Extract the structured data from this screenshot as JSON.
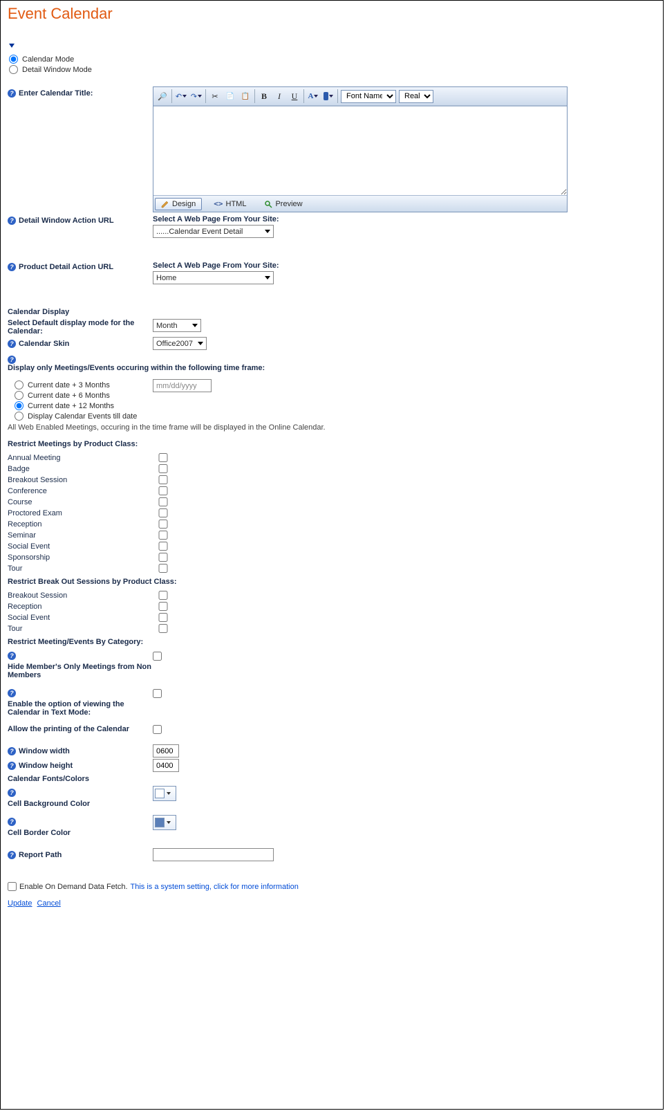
{
  "title": "Event Calendar",
  "mode": {
    "calendar": "Calendar Mode",
    "detail": "Detail Window Mode"
  },
  "labels": {
    "enter_title": "Enter Calendar Title:",
    "detail_action": "Detail Window Action URL",
    "product_action": "Product Detail Action URL",
    "select_page": "Select A Web Page From Your Site:",
    "calendar_display": "Calendar Display",
    "default_display": "Select Default display mode for the Calendar:",
    "calendar_skin": "Calendar Skin",
    "timeframe_intro": "Display only Meetings/Events occuring within the following time frame:",
    "note": "All Web Enabled Meetings, occuring in the time frame will be displayed in the Online Calendar.",
    "restrict_product": "Restrict Meetings by Product Class:",
    "restrict_breakout": "Restrict Break Out Sessions by Product Class:",
    "restrict_category": "Restrict Meeting/Events By Category:",
    "hide_member": "Hide Member's Only Meetings from Non Members",
    "enable_text": "Enable the option of viewing the Calendar in Text Mode:",
    "allow_print": "Allow the printing of the Calendar",
    "win_width": "Window width",
    "win_height": "Window height",
    "fonts_colors": "Calendar Fonts/Colors",
    "cell_bg": "Cell Background Color",
    "cell_border": "Cell Border Color",
    "report_path": "Report Path",
    "ondemand": "Enable On Demand Data Fetch.",
    "ondemand_note": "This is a system setting, click for more information"
  },
  "rte": {
    "font_name": "Font Name",
    "real_size": "Real ...",
    "tab_design": "Design",
    "tab_html": "HTML",
    "tab_preview": "Preview"
  },
  "selects": {
    "detail_page": "......Calendar Event Detail",
    "product_page": "Home",
    "display_mode": "Month",
    "skin": "Office2007"
  },
  "timeframe": {
    "opt3": "Current date + 3 Months",
    "opt6": "Current date + 6 Months",
    "opt12": "Current date + 12 Months",
    "till": "Display Calendar Events till date",
    "date_placeholder": "mm/dd/yyyy"
  },
  "product_classes": [
    "Annual Meeting",
    "Badge",
    "Breakout Session",
    "Conference",
    "Course",
    "Proctored Exam",
    "Reception",
    "Seminar",
    "Social Event",
    "Sponsorship",
    "Tour"
  ],
  "breakout_classes": [
    "Breakout Session",
    "Reception",
    "Social Event",
    "Tour"
  ],
  "values": {
    "win_width": "0600",
    "win_height": "0400",
    "cell_bg": "#ffffff",
    "cell_border": "#5a7fb8"
  },
  "footer": {
    "update": "Update",
    "cancel": "Cancel"
  }
}
